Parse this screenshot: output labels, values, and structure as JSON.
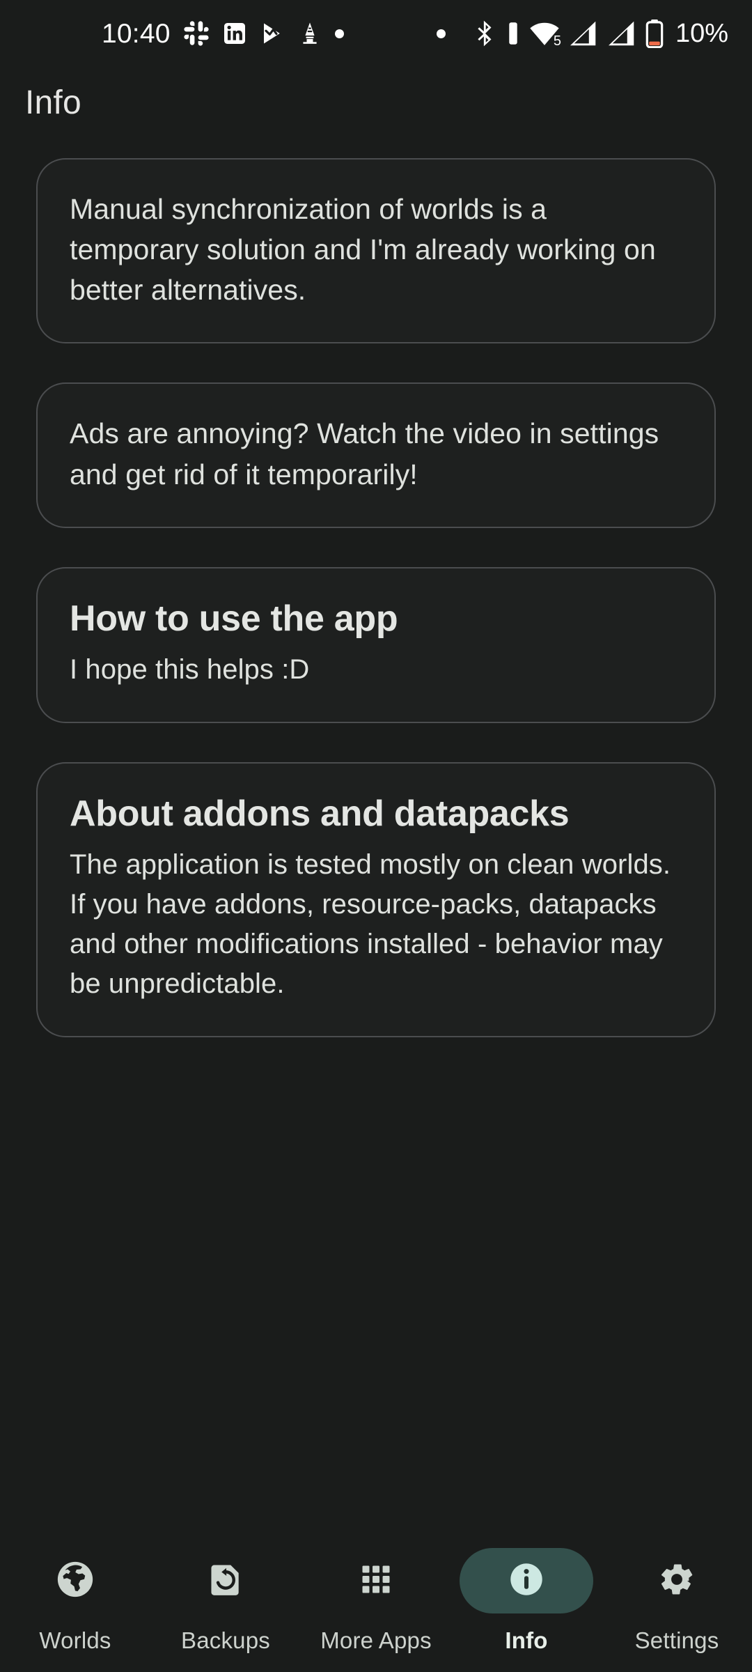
{
  "statusbar": {
    "clock": "10:40",
    "left_icons": [
      "slack-icon",
      "linkedin-icon",
      "play-store-games-icon",
      "alarm-tower-icon",
      "notification-dot-icon"
    ],
    "right_icons": [
      "notification-dot-icon",
      "bluetooth-icon",
      "bluetooth-battery-icon",
      "wifi-icon",
      "signal-sim1-icon",
      "signal-sim2-icon",
      "battery-icon"
    ],
    "wifi_level_label": "5",
    "battery_percent": "10%",
    "battery_accent": "#ef6c4a"
  },
  "header": {
    "title": "Info"
  },
  "cards": [
    {
      "name": "manual-sync-card",
      "title": "",
      "body": "Manual synchronization of worlds is a temporary solution and I'm already working on better alternatives."
    },
    {
      "name": "ads-card",
      "title": "",
      "body": "Ads are annoying? Watch the video in settings and get rid of it temporarily!"
    },
    {
      "name": "how-to-use-card",
      "title": "How to use the app",
      "body": "I hope this helps :D"
    },
    {
      "name": "addons-datapacks-card",
      "title": "About addons and datapacks",
      "body": "The application is tested mostly on clean worlds. If you have addons, resource-packs, datapacks and other modifications installed - behavior may be unpredictable."
    }
  ],
  "bottomnav": {
    "active_index": 3,
    "active_pill_color": "#33504c",
    "active_icon_color": "#cde8e2",
    "icon_color": "#cdd5cf",
    "items": [
      {
        "label": "Worlds",
        "icon": "globe-icon"
      },
      {
        "label": "Backups",
        "icon": "restore-file-icon"
      },
      {
        "label": "More Apps",
        "icon": "grid-apps-icon"
      },
      {
        "label": "Info",
        "icon": "info-circle-icon"
      },
      {
        "label": "Settings",
        "icon": "gear-icon"
      }
    ]
  }
}
